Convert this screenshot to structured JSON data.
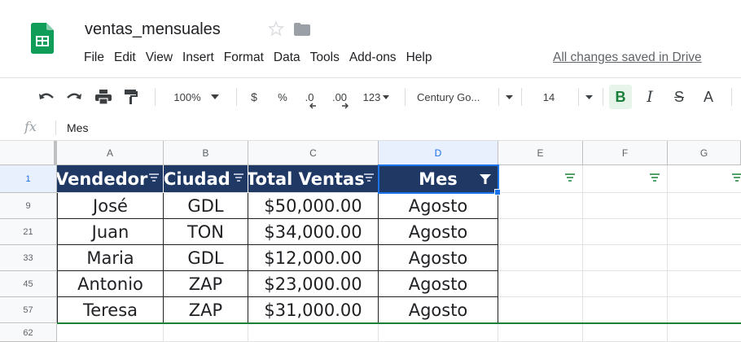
{
  "app": {
    "title": "ventas_mensuales",
    "saved_status": "All changes saved in Drive",
    "colors": {
      "sheets_green": "#0f9d58",
      "header_fill": "#1f3864",
      "selection": "#1a73e8",
      "filter_green": "#188038"
    }
  },
  "menu": [
    "File",
    "Edit",
    "View",
    "Insert",
    "Format",
    "Data",
    "Tools",
    "Add-ons",
    "Help"
  ],
  "toolbar": {
    "zoom": "100%",
    "currency": "$",
    "percent": "%",
    "decrease_decimal": ".0",
    "increase_decimal": ".00",
    "more_formats": "123",
    "font": "Century Go...",
    "font_size": "14",
    "bold": "B",
    "italic": "I",
    "strike": "S",
    "text_color": "A"
  },
  "formula_bar": {
    "fx": "fx",
    "value": "Mes"
  },
  "sheet": {
    "columns": [
      "A",
      "B",
      "C",
      "D",
      "E",
      "F",
      "G"
    ],
    "header_row_number": "1",
    "headers": [
      "Vendedor",
      "Ciudad",
      "Total Ventas",
      "Mes"
    ],
    "rows": [
      {
        "n": "9",
        "cells": [
          "José",
          "GDL",
          "$50,000.00",
          "Agosto"
        ]
      },
      {
        "n": "21",
        "cells": [
          "Juan",
          "TON",
          "$34,000.00",
          "Agosto"
        ]
      },
      {
        "n": "33",
        "cells": [
          "Maria",
          "GDL",
          "$12,000.00",
          "Agosto"
        ]
      },
      {
        "n": "45",
        "cells": [
          "Antonio",
          "ZAP",
          "$23,000.00",
          "Agosto"
        ]
      },
      {
        "n": "57",
        "cells": [
          "Teresa",
          "ZAP",
          "$31,000.00",
          "Agosto"
        ]
      }
    ],
    "last_row_number": "62"
  }
}
